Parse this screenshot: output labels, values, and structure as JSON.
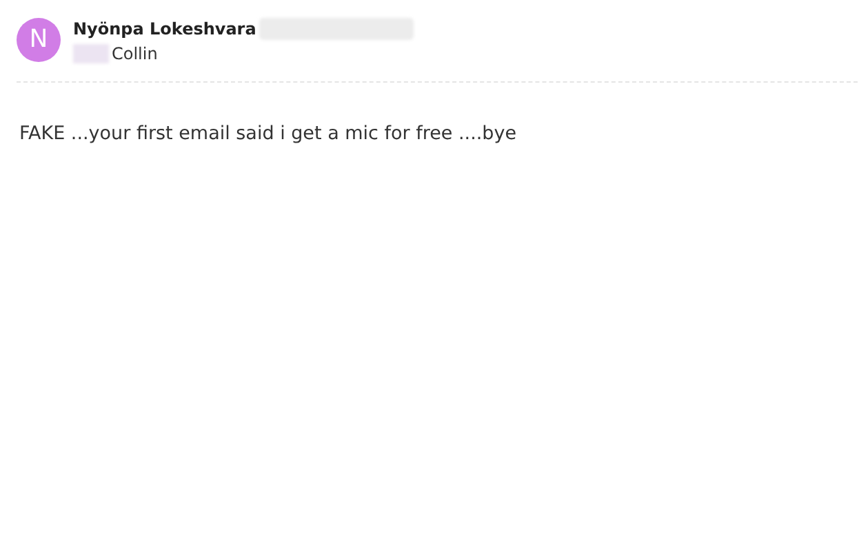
{
  "sender": {
    "avatar_letter": "N",
    "name": "Nyönpa Lokeshvara"
  },
  "recipient": {
    "name": "Collin"
  },
  "body": "FAKE ...your first email said i get a mic for free ....bye"
}
